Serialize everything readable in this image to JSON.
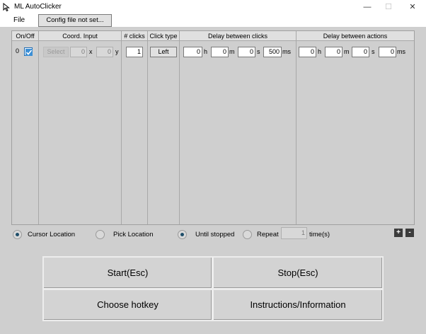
{
  "window": {
    "title": "ML AutoClicker",
    "minimize": "—",
    "maximize": "☐",
    "close": "✕"
  },
  "menu": {
    "file": "File",
    "config_button": "Config file not set..."
  },
  "table": {
    "headers": [
      "On/Off",
      "Coord. Input",
      "# clicks",
      "Click type",
      "Delay between clicks",
      "Delay between actions"
    ],
    "row": {
      "index": "0",
      "enabled": true,
      "select_label": "Select",
      "x_value": "0",
      "x_label": "x",
      "y_value": "0",
      "y_label": "y",
      "clicks": "1",
      "click_type": "Left",
      "click_delay": {
        "h": "0",
        "h_label": "h",
        "m": "0",
        "m_label": "m",
        "s": "0",
        "s_label": "s",
        "ms": "500",
        "ms_label": "ms"
      },
      "action_delay": {
        "h": "0",
        "h_label": "h",
        "m": "0",
        "m_label": "m",
        "s": "0",
        "s_label": "s",
        "ms": "0",
        "ms_label": "ms"
      }
    }
  },
  "options": {
    "cursor_location": "Cursor Location",
    "pick_location": "Pick Location",
    "until_stopped": "Until stopped",
    "repeat": "Repeat",
    "repeat_value": "1",
    "times_label": "time(s)",
    "add": "+",
    "remove": "-"
  },
  "buttons": {
    "start": "Start(Esc)",
    "stop": "Stop(Esc)",
    "hotkey": "Choose hotkey",
    "info": "Instructions/Information"
  },
  "colors": {
    "checkbox_accent": "#1e6ab0",
    "radio_selected": "#1f4e6a"
  }
}
